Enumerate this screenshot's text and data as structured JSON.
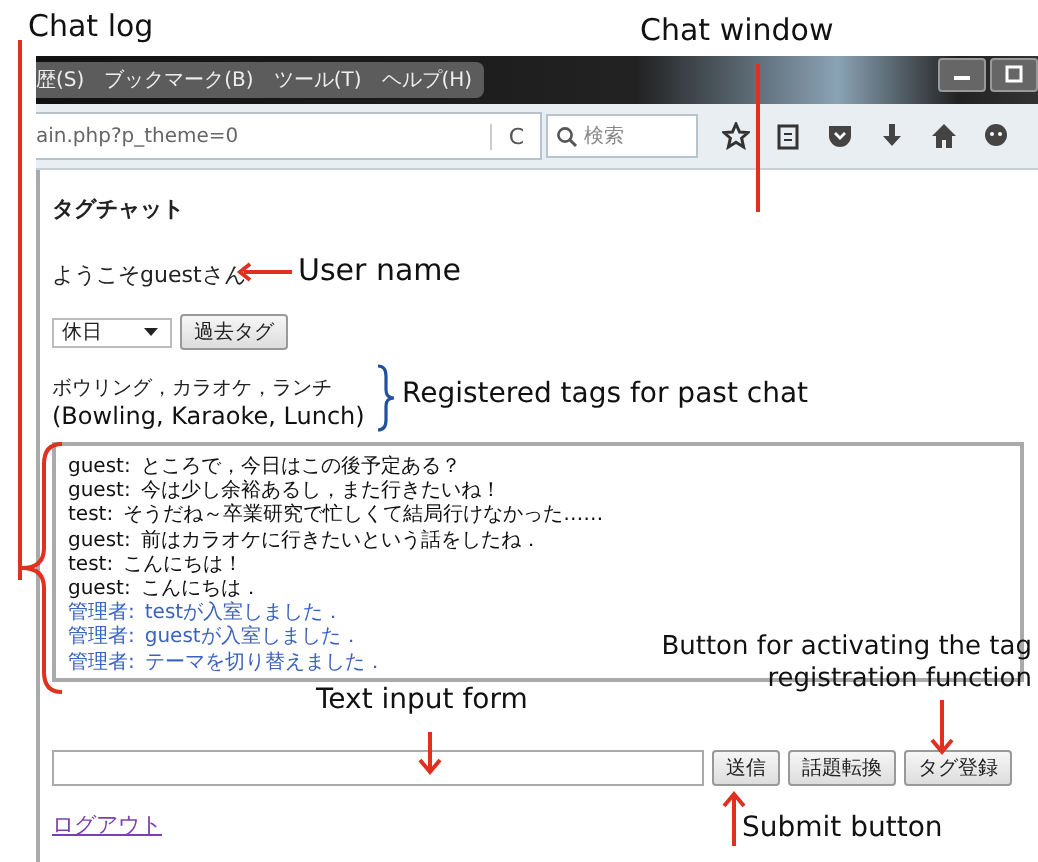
{
  "annotations": [
    {
      "text": "Chat log"
    },
    {
      "text": "Chat window"
    },
    {
      "text": "User name"
    },
    {
      "text": "Registered tags for past chat"
    },
    {
      "text": "Button for activating the tag registration function"
    },
    {
      "text": "Text input form"
    },
    {
      "text": "Submit button"
    }
  ],
  "browser": {
    "menu": [
      "歴(S)",
      "ブックマーク(B)",
      "ツール(T)",
      "ヘルプ(H)"
    ],
    "address": "ain.php?p_theme=0",
    "reload": "C",
    "search": {
      "placeholder": "検索"
    }
  },
  "page": {
    "title": "タグチャット",
    "welcome": "ようこそguestさん",
    "select": {
      "value": "休日"
    },
    "past_tag_button": "過去タグ",
    "tags": "ボウリング，カラオケ，ランチ",
    "tags_translation": "(Bowling, Karaoke, Lunch)",
    "chat_log": [
      {
        "kind": "user",
        "speaker": "guest:",
        "text": "ところで，今日はこの後予定ある？"
      },
      {
        "kind": "user",
        "speaker": "guest:",
        "text": "今は少し余裕あるし，また行きたいね！"
      },
      {
        "kind": "user",
        "speaker": "test:",
        "text": "そうだね～卒業研究で忙しくて結局行けなかった……"
      },
      {
        "kind": "user",
        "speaker": "guest:",
        "text": "前はカラオケに行きたいという話をしたね．"
      },
      {
        "kind": "user",
        "speaker": "test:",
        "text": "こんにちは！"
      },
      {
        "kind": "user",
        "speaker": "guest:",
        "text": "こんにちは．"
      },
      {
        "kind": "admin",
        "speaker": "管理者:",
        "text": "testが入室しました．"
      },
      {
        "kind": "admin",
        "speaker": "管理者:",
        "text": "guestが入室しました．"
      },
      {
        "kind": "admin",
        "speaker": "管理者:",
        "text": "テーマを切り替えました．"
      }
    ],
    "buttons": [
      "送信",
      "話題転換",
      "タグ登録"
    ],
    "logout": "ログアウト"
  }
}
